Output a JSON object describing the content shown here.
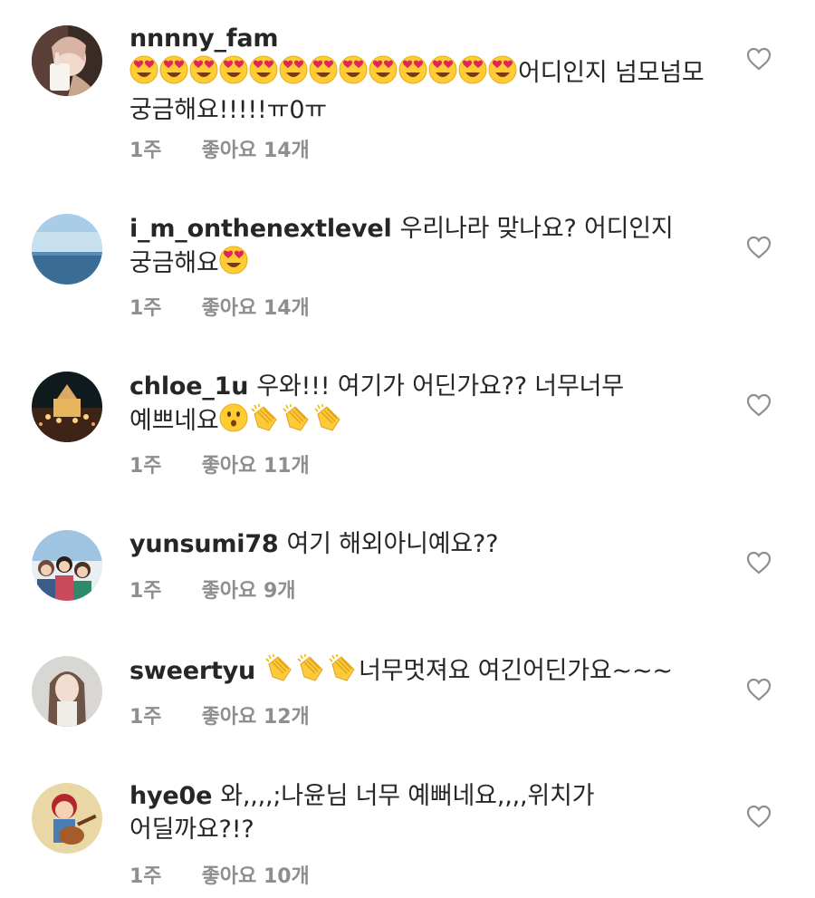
{
  "comments": [
    {
      "username": "nnnny_fam",
      "pre_emoji": [
        "heart-eyes",
        "heart-eyes",
        "heart-eyes",
        "heart-eyes",
        "heart-eyes",
        "heart-eyes",
        "heart-eyes",
        "heart-eyes",
        "heart-eyes",
        "heart-eyes",
        "heart-eyes",
        "heart-eyes",
        "heart-eyes"
      ],
      "text": "어디인지 넘모넘모 궁금해요!!!!!ㅠ0ㅠ",
      "post_emoji": [],
      "tail": "",
      "time": "1주",
      "likes": "좋아요 14개",
      "avatar": "avatar-drink"
    },
    {
      "username": "i_m_onthenextlevel",
      "pre_emoji": [],
      "text": "우리나라 맞나요? 어디인지 궁금해요",
      "post_emoji": [
        "heart-eyes"
      ],
      "tail": "",
      "time": "1주",
      "likes": "좋아요 14개",
      "avatar": "avatar-sea"
    },
    {
      "username": "chloe_1u",
      "pre_emoji": [],
      "text": "우와!!! 여기가 어딘가요?? 너무너무 예쁘네요",
      "post_emoji": [
        "hushed-face",
        "clapping-hands",
        "clapping-hands",
        "clapping-hands"
      ],
      "tail": "",
      "time": "1주",
      "likes": "좋아요 11개",
      "avatar": "avatar-carousel"
    },
    {
      "username": "yunsumi78",
      "pre_emoji": [],
      "text": "여기 해외아니예요??",
      "post_emoji": [],
      "tail": "",
      "time": "1주",
      "likes": "좋아요 9개",
      "avatar": "avatar-group"
    },
    {
      "username": "sweertyu",
      "pre_emoji": [
        "clapping-hands",
        "clapping-hands",
        "clapping-hands"
      ],
      "text": "너무멋져요 여긴어딘가요~~~",
      "post_emoji": [],
      "tail": "",
      "time": "1주",
      "likes": "좋아요 12개",
      "avatar": "avatar-girl"
    },
    {
      "username": "hye0e",
      "pre_emoji": [],
      "text": "와,,,,;나윤님 너무 예뻐네요,,,,위치가 어딜까요?!?",
      "post_emoji": [],
      "tail": "",
      "time": "1주",
      "likes": "좋아요 10개",
      "avatar": "avatar-guitar"
    }
  ],
  "colors": {
    "username": "#262626",
    "meta": "#8e8e8e",
    "heart_outline": "#8e8e8e"
  },
  "icons": {
    "like": "heart-outline-icon"
  }
}
